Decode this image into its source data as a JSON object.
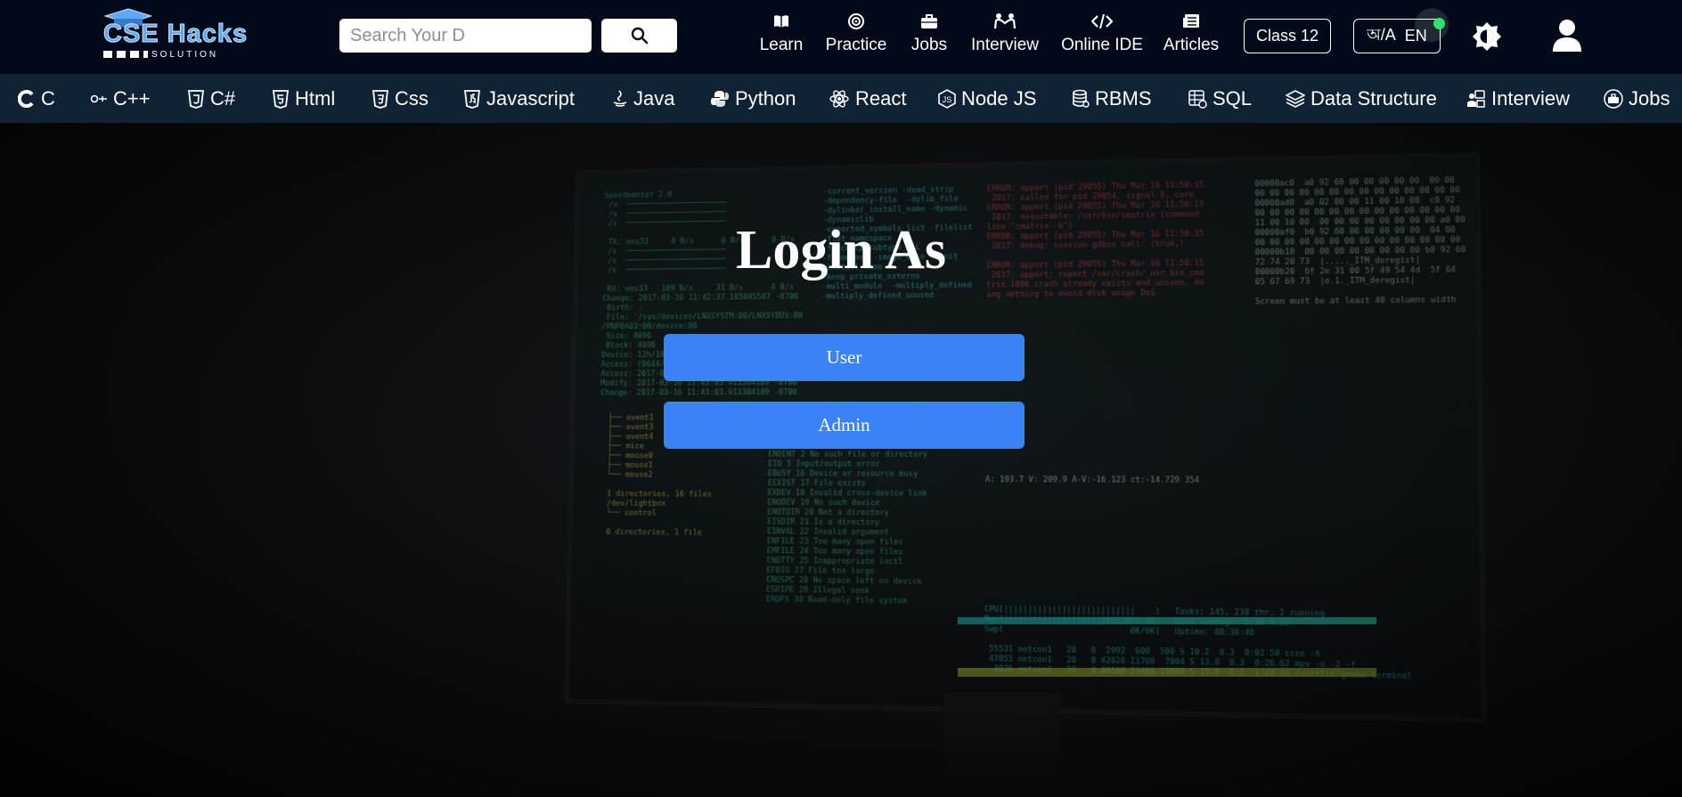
{
  "header": {
    "logo": {
      "title": "CSE Hacks",
      "subtitle": "SOLUTION",
      "icon": "graduation-cap-icon"
    },
    "search": {
      "placeholder": "Search Your D",
      "value": "",
      "button_icon": "search-icon"
    },
    "nav": [
      {
        "label": "Learn",
        "icon": "book-open-icon"
      },
      {
        "label": "Practice",
        "icon": "target-icon"
      },
      {
        "label": "Jobs",
        "icon": "briefcase-icon"
      },
      {
        "label": "Interview",
        "icon": "people-handshake-icon"
      },
      {
        "label": "Online IDE",
        "icon": "code-icon"
      },
      {
        "label": "Articles",
        "icon": "newspaper-icon"
      }
    ],
    "class_button": "Class 12",
    "language": {
      "left": "অ/A",
      "right": "EN"
    },
    "theme_icon": "brightness-icon",
    "user_icon": "user-icon"
  },
  "courses": [
    {
      "label": "C",
      "icon": "c-icon"
    },
    {
      "label": "C++",
      "icon": "cpp-icon"
    },
    {
      "label": "C#",
      "icon": "csharp-icon"
    },
    {
      "label": "Html",
      "icon": "html5-icon"
    },
    {
      "label": "Css",
      "icon": "css3-icon"
    },
    {
      "label": "Javascript",
      "icon": "js-icon"
    },
    {
      "label": "Java",
      "icon": "java-icon"
    },
    {
      "label": "Python",
      "icon": "python-icon"
    },
    {
      "label": "React",
      "icon": "react-icon"
    },
    {
      "label": "Node JS",
      "icon": "nodejs-icon"
    },
    {
      "label": "RBMS",
      "icon": "database-icon"
    },
    {
      "label": "SQL",
      "icon": "sql-icon"
    },
    {
      "label": "Data Structure",
      "icon": "layers-icon"
    },
    {
      "label": "Interview",
      "icon": "interview-icon"
    },
    {
      "label": "Jobs",
      "icon": "jobs-icon"
    }
  ],
  "main": {
    "title": "Login As",
    "buttons": {
      "user": "User",
      "admin": "Admin"
    },
    "accent_color": "#3b82f6"
  }
}
